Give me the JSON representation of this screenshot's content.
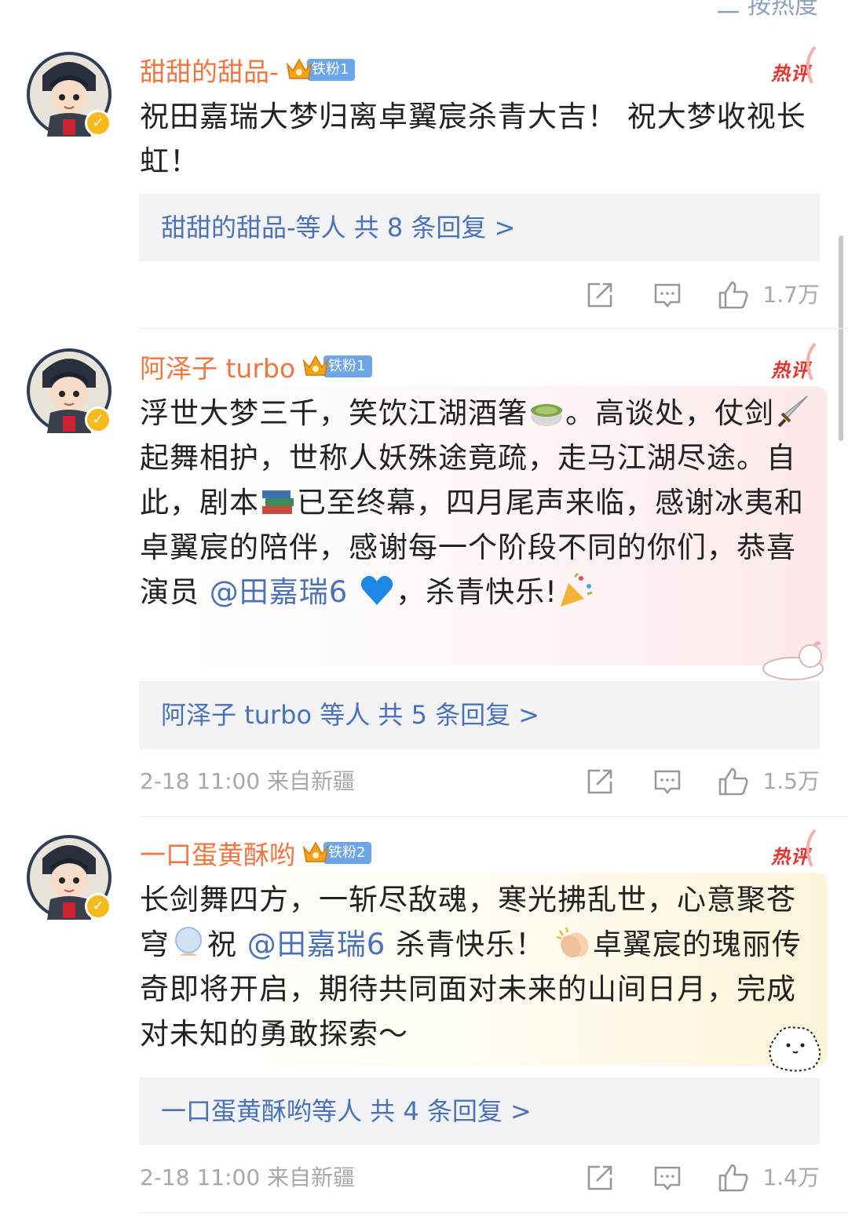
{
  "header": {
    "sort_label": "二 按热度"
  },
  "comments": [
    {
      "username": "甜甜的甜品-",
      "fan_badge": "铁粉1",
      "hot_label": "热评",
      "content": "祝田嘉瑞大梦归离卓翼宸杀青大吉！ 祝大梦收视长虹！",
      "reply_text": "甜甜的甜品-等人  共 8 条回复 >",
      "meta": "",
      "like_count": "1.7万"
    },
    {
      "username": "阿泽子 turbo",
      "fan_badge": "铁粉1",
      "hot_label": "热评",
      "content_parts": {
        "p1": "浮世大梦三千，笑饮江湖酒箸",
        "p2": "。高谈处，仗剑",
        "p3": "起舞相护，世称人妖殊途竟疏，走马江湖尽途。自此，剧本",
        "p4": "已至终幕，四月尾声来临，感谢冰夷和卓翼宸的陪伴，感谢每一个阶段不同的你们，恭喜演员",
        "mention": "@田嘉瑞6",
        "p5": "，杀青快乐!"
      },
      "emoji_names": [
        "tea-emoji",
        "dagger-emoji",
        "books-emoji",
        "blue-heart-emoji",
        "party-popper-emoji"
      ],
      "reply_text": "阿泽子 turbo 等人  共 5 条回复 >",
      "meta": "2-18 11:00  来自新疆",
      "like_count": "1.5万"
    },
    {
      "username": "一口蛋黄酥哟",
      "fan_badge": "铁粉2",
      "hot_label": "热评",
      "content_parts": {
        "p1": "长剑舞四方，一斩尽敌魂，寒光拂乱世，心意聚苍穹",
        "p2": "祝",
        "mention": "@田嘉瑞6",
        "p3": "杀青快乐！",
        "p4": "卓翼宸的瑰丽传奇即将开启，期待共同面对未来的山间日月，完成对未知的勇敢探索～"
      },
      "emoji_names": [
        "crystal-ball-emoji",
        "clapping-hands-emoji"
      ],
      "reply_text": "一口蛋黄酥哟等人  共 4 条回复 >",
      "meta": "2-18 11:00  来自新疆",
      "like_count": "1.4万"
    }
  ],
  "colors": {
    "username": "#f2753f",
    "link": "#4a72b8",
    "hot": "#e8322b",
    "meta": "#a8a8a8",
    "reply_bg": "#f3f3f5"
  }
}
